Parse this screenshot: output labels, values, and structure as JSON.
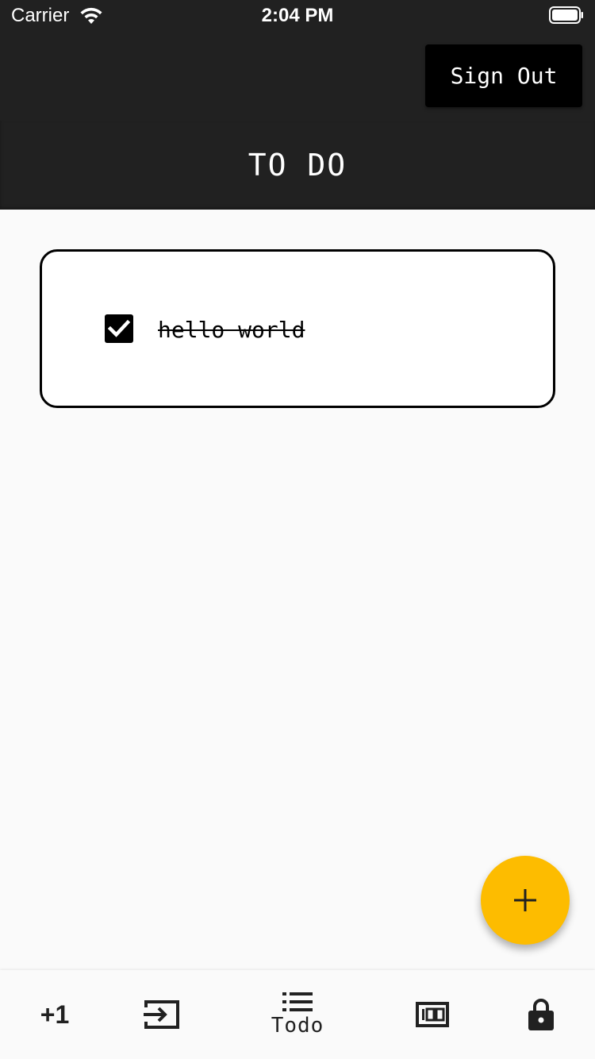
{
  "status_bar": {
    "carrier": "Carrier",
    "time": "2:04 PM",
    "icons": [
      "wifi-icon",
      "battery-icon"
    ]
  },
  "app_bar": {
    "sign_out_label": "Sign Out",
    "title": "TO DO",
    "background": "#212121"
  },
  "todos": [
    {
      "text": "hello world",
      "checked": true
    }
  ],
  "fab": {
    "icon": "plus-icon",
    "color": "#fdbc00"
  },
  "bottom_nav": {
    "items": [
      {
        "icon": "plus-one-icon",
        "label": "+1"
      },
      {
        "icon": "input-icon",
        "label": ""
      },
      {
        "icon": "list-icon",
        "label": "Todo",
        "selected": true
      },
      {
        "icon": "counter-100-icon",
        "label": ""
      },
      {
        "icon": "lock-icon",
        "label": ""
      }
    ]
  }
}
